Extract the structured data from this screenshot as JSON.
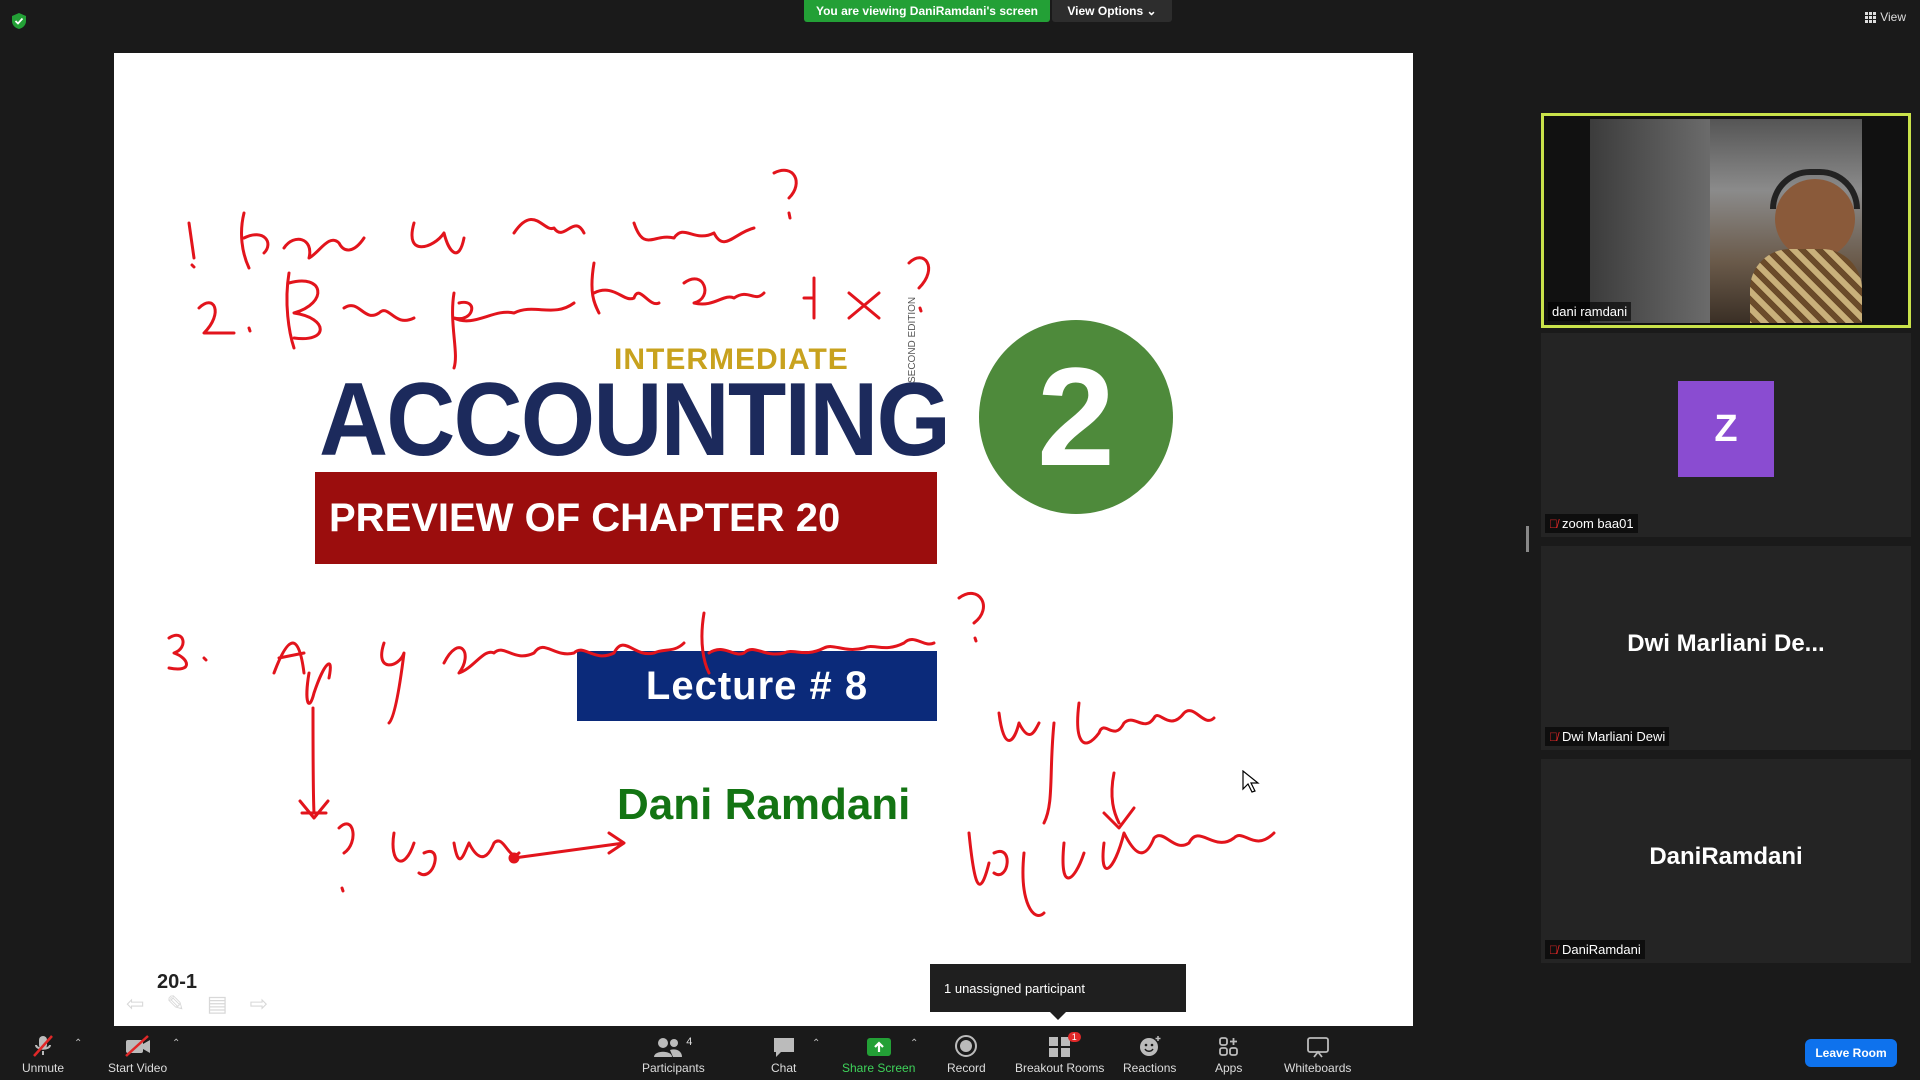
{
  "top_bar": {
    "viewing_banner": "You are viewing DaniRamdani's screen",
    "view_options": "View Options",
    "view_label": "View",
    "security_icon": "green-shield-icon"
  },
  "slide": {
    "intermediate": "INTERMEDIATE",
    "accounting": "ACCOUNTING",
    "edition": "SECOND EDITION",
    "chapter": "PREVIEW OF CHAPTER  20",
    "volume": "2",
    "lecture": "Lecture  #  8",
    "author": "Dani Ramdani",
    "slide_number": "20-1",
    "colors": {
      "intermediate": "#c8a21e",
      "accounting": "#1c2a5c",
      "chapter_bg": "#9b0d0d",
      "circle": "#4e8a3b",
      "lecture_bg": "#0b2a7a",
      "author": "#137413",
      "ink": "#e2141c"
    }
  },
  "tooltip": {
    "text": "1 unassigned participant"
  },
  "participants": [
    {
      "name": "dani ramdani",
      "type": "video",
      "active_speaker": true
    },
    {
      "name": "zoom baa01",
      "type": "avatar",
      "initial": "Z",
      "muted": true
    },
    {
      "name": "Dwi Marliani Dewi",
      "display": "Dwi Marliani De...",
      "type": "name",
      "muted": true
    },
    {
      "name": "DaniRamdani",
      "display": "DaniRamdani",
      "type": "name",
      "muted": true
    }
  ],
  "toolbar": {
    "unmute": "Unmute",
    "start_video": "Start Video",
    "participants": "Participants",
    "participants_count": "4",
    "chat": "Chat",
    "share_screen": "Share Screen",
    "record": "Record",
    "breakout_rooms": "Breakout Rooms",
    "breakout_badge": "1",
    "reactions": "Reactions",
    "apps": "Apps",
    "whiteboards": "Whiteboards",
    "leave_room": "Leave Room"
  }
}
